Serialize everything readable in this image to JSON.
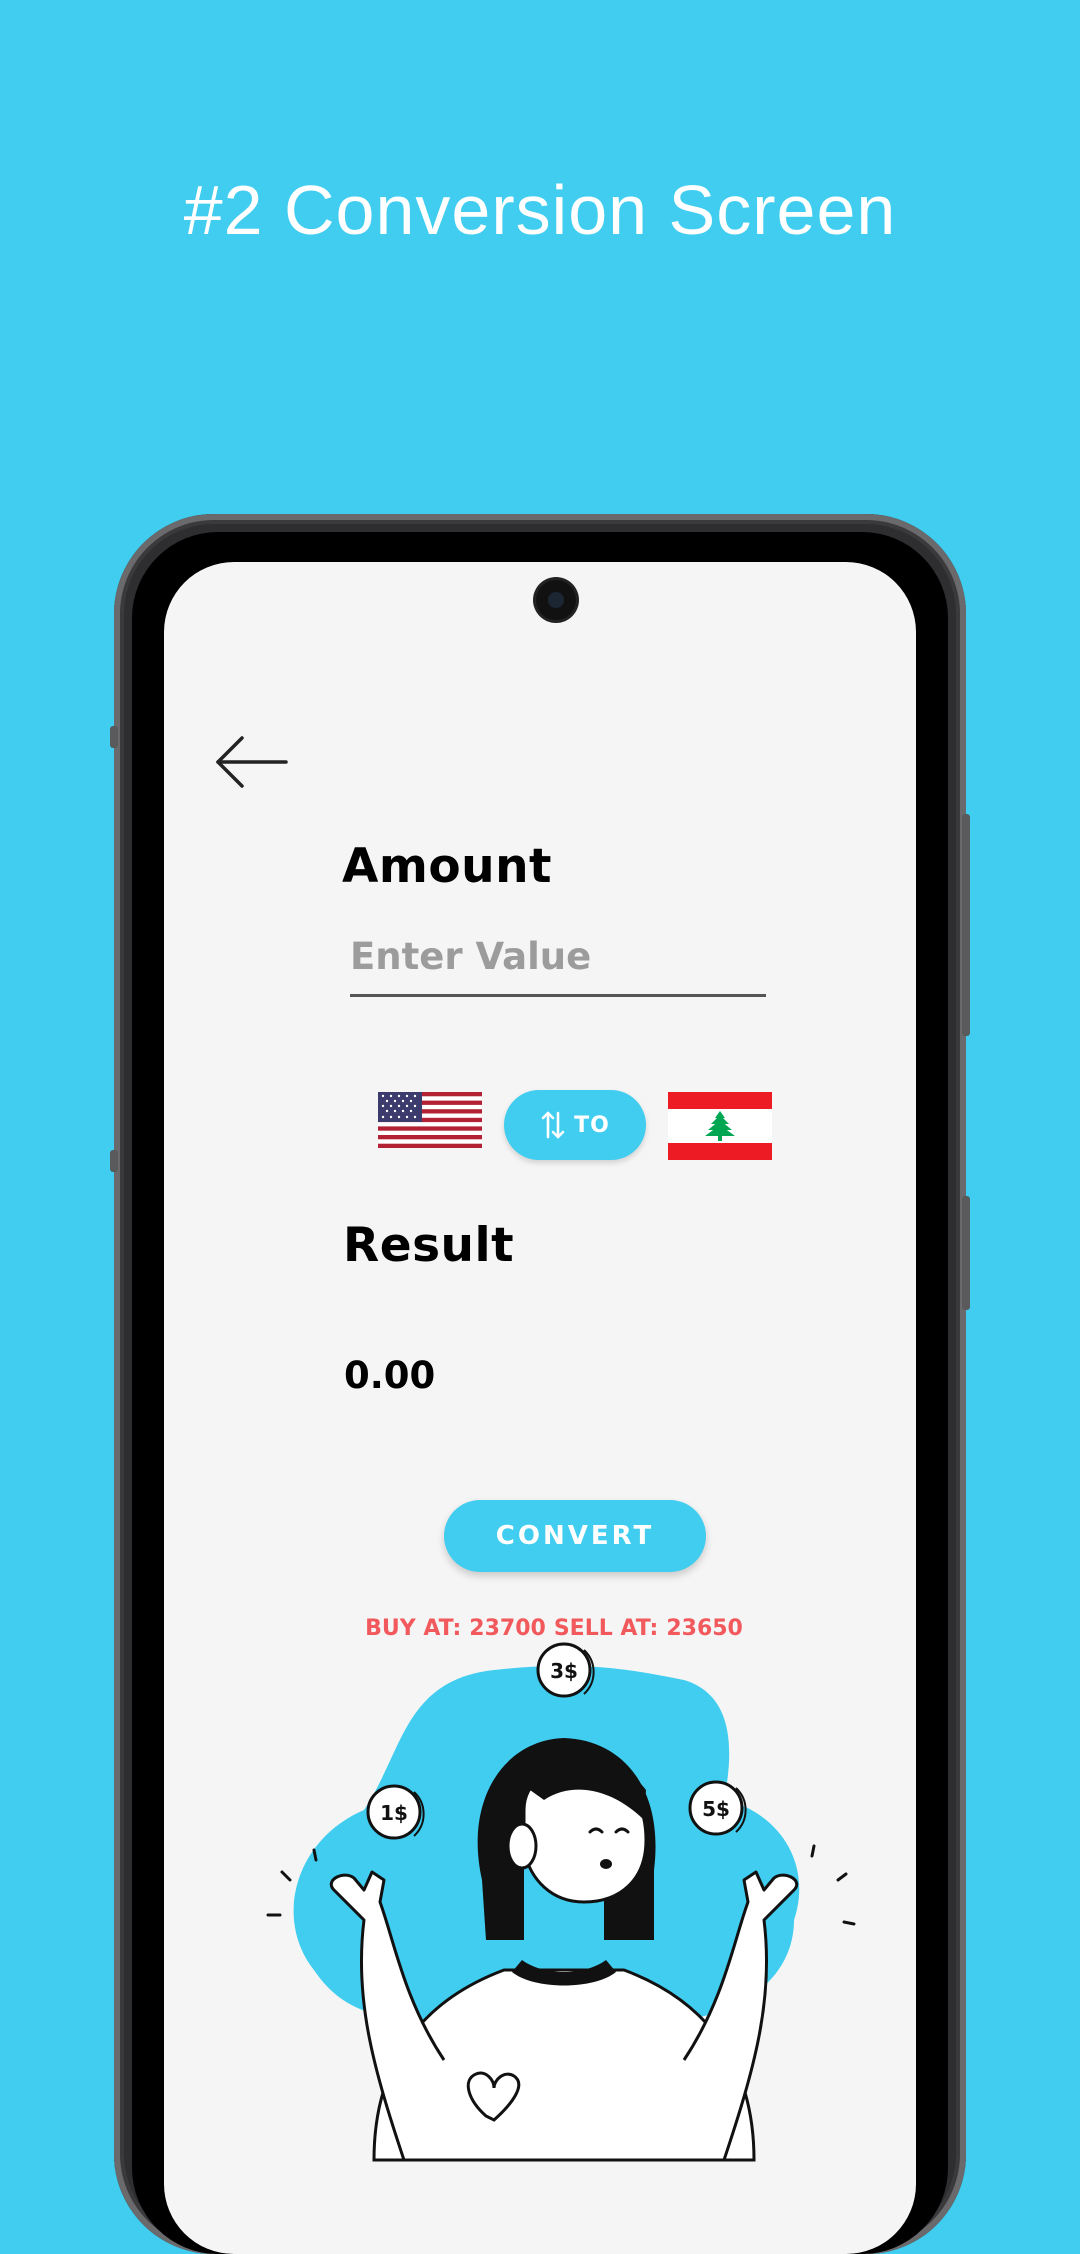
{
  "headline": "#2 Conversion Screen",
  "app": {
    "amount_label": "Amount",
    "input_placeholder": "Enter Value",
    "swap_label": "TO",
    "result_label": "Result",
    "result_value": "0.00",
    "convert_label": "CONVERT",
    "rates": {
      "buy_label": "BUY AT:",
      "buy_value": "23700",
      "sell_label": "SELL AT:",
      "sell_value": "23650"
    },
    "coins": [
      "3$",
      "1$",
      "5$"
    ],
    "from_currency_flag": "us-flag",
    "to_currency_flag": "lebanon-flag"
  },
  "colors": {
    "background": "#40CDEF",
    "accent": "#40CDEF",
    "rate_text": "#F2595C",
    "screen": "#F5F5F5"
  },
  "icons": [
    "arrow-left-icon",
    "swap-vertical-icon"
  ]
}
